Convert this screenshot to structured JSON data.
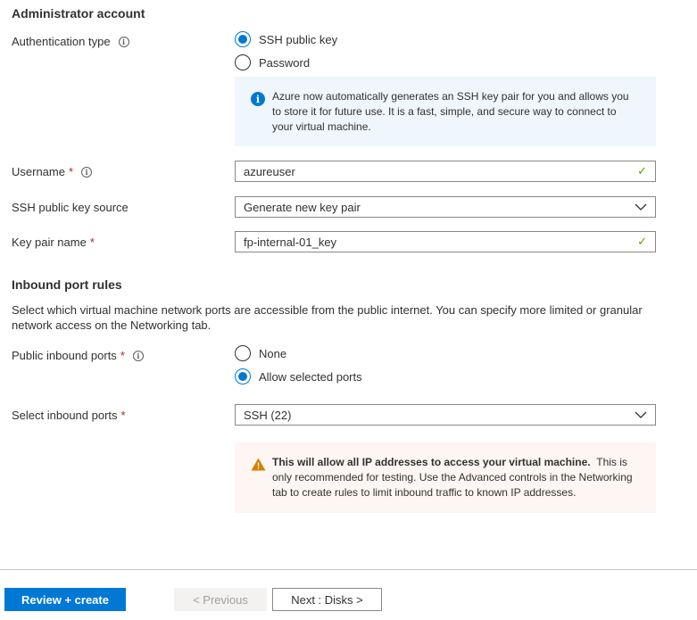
{
  "admin": {
    "section_title": "Administrator account",
    "auth_label": "Authentication type",
    "auth_options": [
      "SSH public key",
      "Password"
    ],
    "auth_selected": "SSH public key",
    "info_text": "Azure now automatically generates an SSH key pair for you and allows you to store it for future use. It is a fast, simple, and secure way to connect to your virtual machine.",
    "username_label": "Username",
    "username_value": "azureuser",
    "ssh_source_label": "SSH public key source",
    "ssh_source_value": "Generate new key pair",
    "keypair_label": "Key pair name",
    "keypair_value": "fp-internal-01_key"
  },
  "inbound": {
    "section_title": "Inbound port rules",
    "description": "Select which virtual machine network ports are accessible from the public internet. You can specify more limited or granular network access on the Networking tab.",
    "public_ports_label": "Public inbound ports",
    "public_ports_options": [
      "None",
      "Allow selected ports"
    ],
    "public_ports_selected": "Allow selected ports",
    "select_ports_label": "Select inbound ports",
    "select_ports_value": "SSH (22)",
    "warning_bold": "This will allow all IP addresses to access your virtual machine.",
    "warning_text": "This is only recommended for testing.  Use the Advanced controls in the Networking tab to create rules to limit inbound traffic to known IP addresses."
  },
  "footer": {
    "review_label": "Review + create",
    "previous_label": "< Previous",
    "next_label": "Next : Disks >"
  },
  "required_mark": "*",
  "info_icon_glyph": "i",
  "check_glyph": "✓",
  "warning_glyph": "!",
  "colors": {
    "accent": "#0078d4",
    "required": "#a4262c",
    "success": "#57a300",
    "warning": "#d67f00",
    "info_bg": "#eff6fc",
    "warn_bg": "#fdf6f3"
  }
}
